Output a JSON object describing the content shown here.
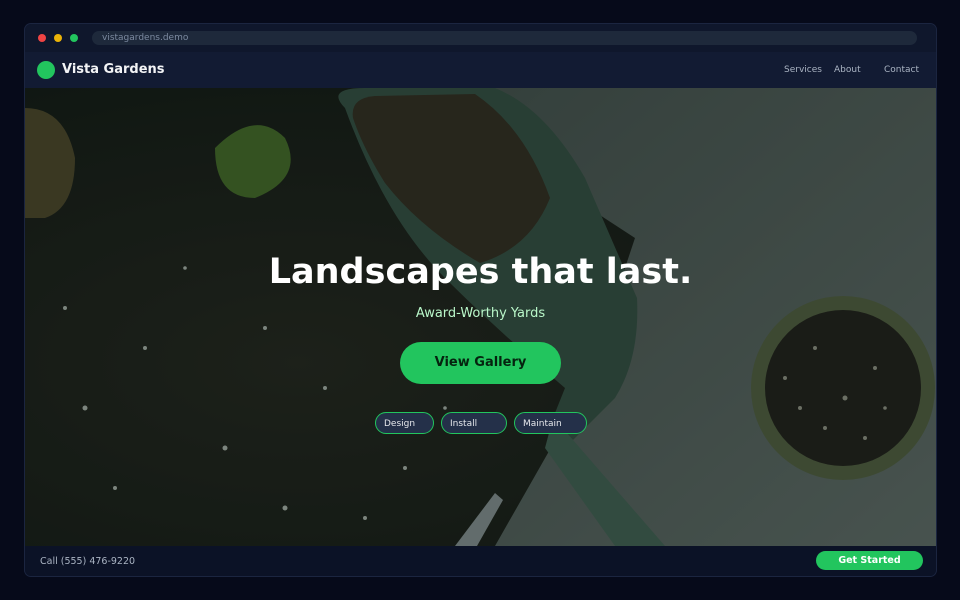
{
  "browser": {
    "url": "vistagardens.demo"
  },
  "nav": {
    "brand": "Vista Gardens",
    "links": [
      "Services",
      "About",
      "Contact"
    ]
  },
  "hero": {
    "headline": "Landscapes that last.",
    "subhead": "Award-Worthy Yards",
    "cta_label": "View Gallery",
    "chips": [
      "Design",
      "Install",
      "Maintain"
    ],
    "image_alt": "garden trowel with soil and potted plant"
  },
  "footer": {
    "phone": "Call (555) 476-9220",
    "cta_label": "Get Started"
  },
  "colors": {
    "accent": "#22c55e",
    "page_background": "#060a1a",
    "nav_background": "#121b33"
  },
  "icons": [
    "close-window-dot",
    "minimize-window-dot",
    "maximize-window-dot",
    "logo-dot"
  ]
}
